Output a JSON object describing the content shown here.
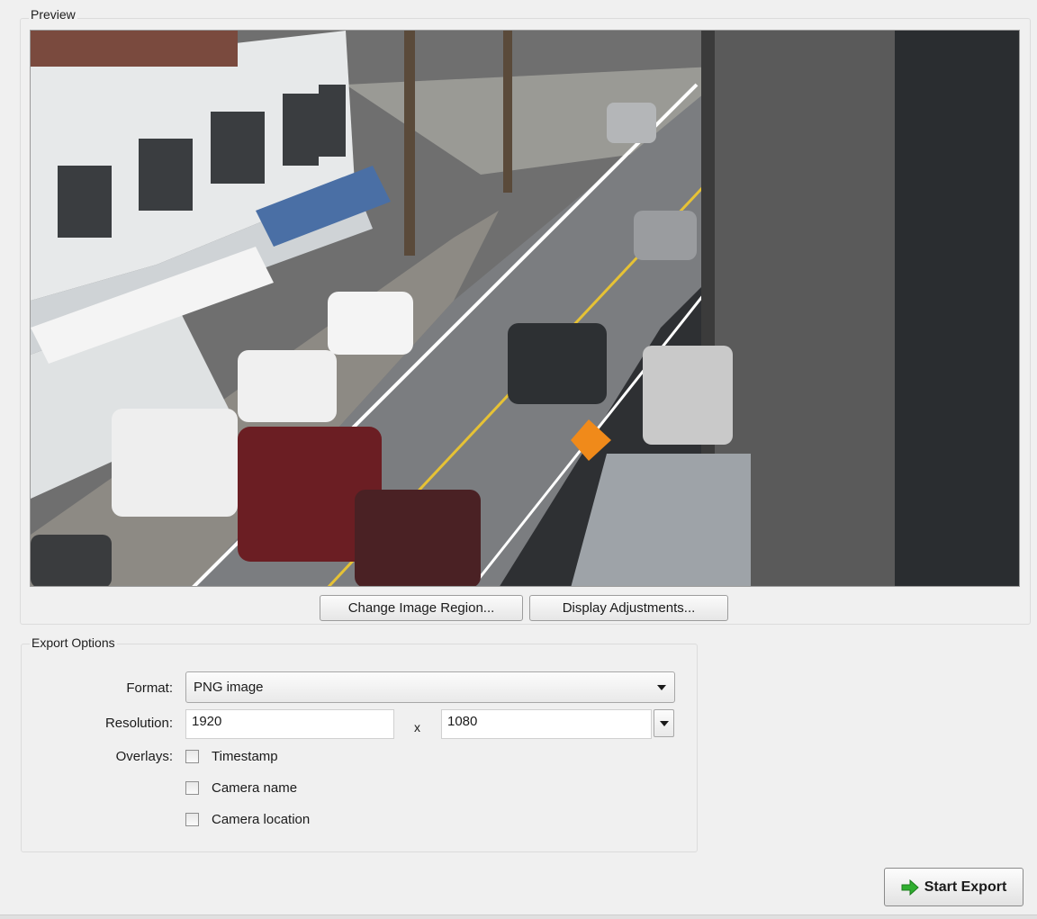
{
  "preview": {
    "label": "Preview",
    "change_region_label": "Change Image Region...",
    "display_adjustments_label": "Display Adjustments..."
  },
  "export_options": {
    "label": "Export Options",
    "format_label": "Format:",
    "format_value": "PNG image",
    "resolution_label": "Resolution:",
    "resolution_width": "1920",
    "resolution_separator": "x",
    "resolution_height": "1080",
    "overlays_label": "Overlays:",
    "overlays": [
      {
        "label": "Timestamp",
        "checked": false
      },
      {
        "label": "Camera name",
        "checked": false
      },
      {
        "label": "Camera location",
        "checked": false
      }
    ]
  },
  "actions": {
    "start_export_label": "Start Export"
  },
  "colors": {
    "start_icon": "#2fae2f",
    "background": "#f0f0f0"
  }
}
